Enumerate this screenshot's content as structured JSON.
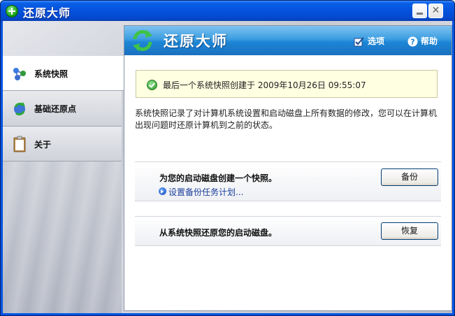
{
  "window": {
    "title": "还原大师"
  },
  "nav": {
    "items": [
      {
        "label": "系统快照",
        "icon": "network-icon",
        "active": true
      },
      {
        "label": "基础还原点",
        "icon": "restore-point-icon",
        "active": false
      },
      {
        "label": "关于",
        "icon": "clipboard-icon",
        "active": false
      }
    ]
  },
  "banner": {
    "title": "还原大师",
    "options_label": "选项",
    "help_label": "帮助"
  },
  "status": {
    "message": "最后一个系统快照创建于 2009年10月26日 09:55:07"
  },
  "description": "系统快照记录了对计算机系统设置和启动磁盘上所有数据的修改，您可以在计算机出现问题时还原计算机到之前的状态。",
  "backup": {
    "title": "为您的启动磁盘创建一个快照。",
    "link": "设置备份任务计划...",
    "button": "备份"
  },
  "restore": {
    "title": "从系统快照还原您的启动磁盘。",
    "button": "恢复"
  },
  "colors": {
    "titlebar": "#0552dc",
    "banner": "#1d86d6",
    "info_bg": "#ffffe1",
    "link": "#1a3d9a"
  }
}
